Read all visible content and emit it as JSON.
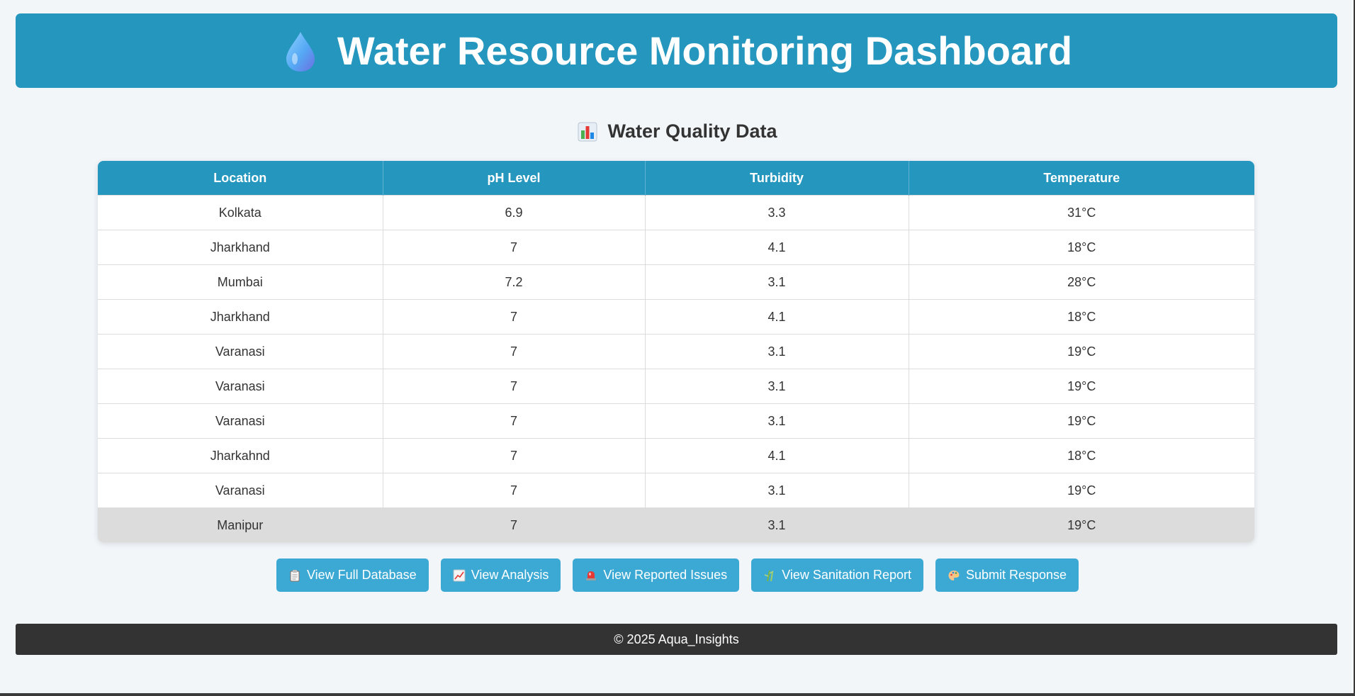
{
  "header": {
    "icon": "water-drop-icon",
    "title": "Water Resource Monitoring Dashboard"
  },
  "section": {
    "icon": "bar-chart-icon",
    "title": "Water Quality Data"
  },
  "table": {
    "columns": [
      "Location",
      "pH Level",
      "Turbidity",
      "Temperature"
    ],
    "rows": [
      {
        "location": "Kolkata",
        "ph": "6.9",
        "turbidity": "3.3",
        "temperature": "31°C"
      },
      {
        "location": "Jharkhand",
        "ph": "7",
        "turbidity": "4.1",
        "temperature": "18°C"
      },
      {
        "location": "Mumbai",
        "ph": "7.2",
        "turbidity": "3.1",
        "temperature": "28°C"
      },
      {
        "location": "Jharkhand",
        "ph": "7",
        "turbidity": "4.1",
        "temperature": "18°C"
      },
      {
        "location": "Varanasi",
        "ph": "7",
        "turbidity": "3.1",
        "temperature": "19°C"
      },
      {
        "location": "Varanasi",
        "ph": "7",
        "turbidity": "3.1",
        "temperature": "19°C"
      },
      {
        "location": "Varanasi",
        "ph": "7",
        "turbidity": "3.1",
        "temperature": "19°C"
      },
      {
        "location": "Jharkahnd",
        "ph": "7",
        "turbidity": "4.1",
        "temperature": "18°C"
      },
      {
        "location": "Varanasi",
        "ph": "7",
        "turbidity": "3.1",
        "temperature": "19°C"
      },
      {
        "location": "Manipur",
        "ph": "7",
        "turbidity": "3.1",
        "temperature": "19°C"
      }
    ]
  },
  "actions": [
    {
      "icon": "clipboard-icon",
      "label": "View Full Database"
    },
    {
      "icon": "trend-chart-icon",
      "label": "View Analysis"
    },
    {
      "icon": "siren-icon",
      "label": "View Reported Issues"
    },
    {
      "icon": "bamboo-icon",
      "label": "View Sanitation Report"
    },
    {
      "icon": "palette-icon",
      "label": "Submit Response"
    }
  ],
  "footer": {
    "text": "© 2025 Aqua_Insights"
  },
  "colors": {
    "primary": "#2596be",
    "button": "#3ba9d4",
    "footer": "#333333",
    "background": "#f2f6f9",
    "highlight_row": "#dcdcdc"
  }
}
